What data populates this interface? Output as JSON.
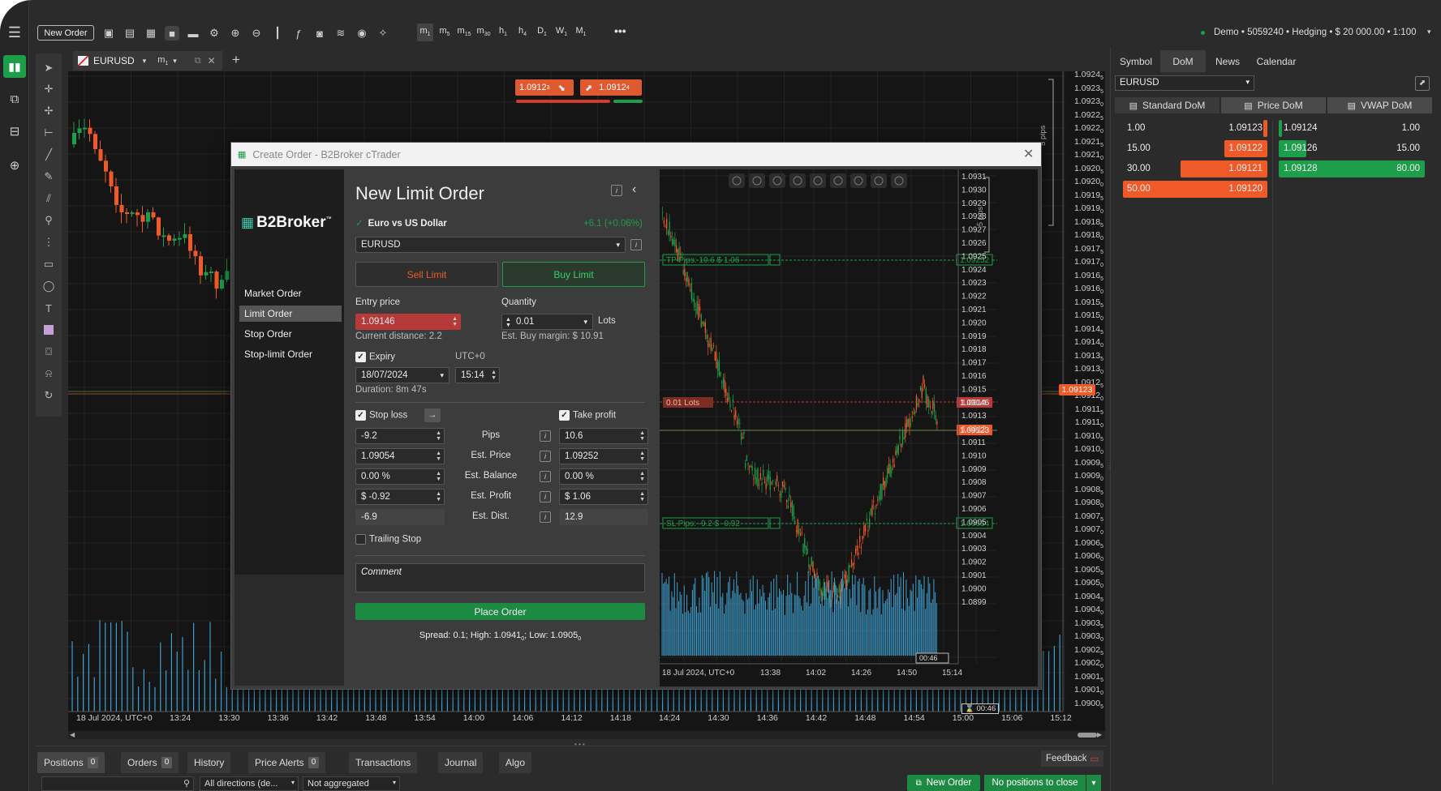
{
  "toolbar": {
    "new_order": "New Order",
    "timeframes": [
      {
        "main": "m",
        "sub": "1"
      },
      {
        "main": "m",
        "sub": "5"
      },
      {
        "main": "m",
        "sub": "15"
      },
      {
        "main": "m",
        "sub": "30"
      },
      {
        "main": "h",
        "sub": "1"
      },
      {
        "main": "h",
        "sub": "4"
      },
      {
        "main": "D",
        "sub": "1"
      },
      {
        "main": "W",
        "sub": "1"
      },
      {
        "main": "M",
        "sub": "1"
      }
    ],
    "account": "Demo • 5059240 • Hedging • $ 20 000.00 • 1:100"
  },
  "chart_tab": {
    "symbol": "EURUSD",
    "timeframe_main": "m",
    "timeframe_sub": "1"
  },
  "quick_trade": {
    "sell": "1.0912",
    "sell_sup": "3",
    "buy": "1.0912",
    "buy_sup": "4"
  },
  "main_chart": {
    "y_labels": [
      "1.0924",
      "1.0923",
      "1.0923",
      "1.0922",
      "1.0922",
      "1.0921",
      "1.0921",
      "1.0920",
      "1.0920",
      "1.0919",
      "1.0919",
      "1.0918",
      "1.0918",
      "1.0917",
      "1.0917",
      "1.0916",
      "1.0916",
      "1.0915",
      "1.0915",
      "1.0914",
      "1.0914",
      "1.0913",
      "1.0913",
      "1.0912",
      "1.0912",
      "1.0911",
      "1.0911",
      "1.0910",
      "1.0910",
      "1.0909",
      "1.0909",
      "1.0908",
      "1.0908",
      "1.0907",
      "1.0907",
      "1.0906",
      "1.0906",
      "1.0905",
      "1.0905",
      "1.0904",
      "1.0904",
      "1.0903",
      "1.0903",
      "1.0902",
      "1.0902",
      "1.0901",
      "1.0901",
      "1.0900"
    ],
    "y_subs": [
      "5",
      "5",
      "0",
      "5",
      "0",
      "5",
      "0",
      "5",
      "0",
      "5",
      "0",
      "5",
      "0",
      "5",
      "0",
      "5",
      "0",
      "5",
      "0",
      "5",
      "0",
      "5",
      "0",
      "5",
      "0",
      "5",
      "0",
      "5",
      "0",
      "5",
      "0",
      "5",
      "0",
      "5",
      "0",
      "5",
      "0",
      "5",
      "0",
      "5",
      "0",
      "5",
      "0",
      "5",
      "0",
      "5",
      "0",
      "5"
    ],
    "price_tag": "1.09123",
    "x_labels": [
      "18 Jul 2024, UTC+0",
      "13:24",
      "13:30",
      "13:36",
      "13:42",
      "13:48",
      "13:54",
      "14:00",
      "14:06",
      "14:12",
      "14:18",
      "14:24",
      "14:30",
      "14:36",
      "14:42",
      "14:48",
      "14:54",
      "15:00",
      "15:06",
      "15:12"
    ],
    "countdown": "00:46",
    "pips_label": "5 pips"
  },
  "dialog": {
    "title": "Create Order - B2Broker cTrader",
    "brand": "B2Broker",
    "menu": [
      "Market Order",
      "Limit Order",
      "Stop Order",
      "Stop-limit Order"
    ],
    "heading": "New Limit Order",
    "instrument_name": "Euro vs US Dollar",
    "change": "+6.1 (+0.06%)",
    "symbol": "EURUSD",
    "sell_limit": "Sell Limit",
    "buy_limit": "Buy Limit",
    "entry_price_label": "Entry price",
    "entry_price": "1.09146",
    "current_distance": "Current distance: 2.2",
    "quantity_label": "Quantity",
    "quantity": "0.01",
    "lots": "Lots",
    "est_buy_margin": "Est. Buy margin: $ 10.91",
    "expiry_label": "Expiry",
    "utc_label": "UTC+0",
    "expiry_date": "18/07/2024",
    "expiry_time": "15:14",
    "duration": "Duration: 8m 47s",
    "stop_loss_label": "Stop loss",
    "take_profit_label": "Take profit",
    "rows": [
      {
        "label": "Pips",
        "sl": "-9.2",
        "tp": "10.6"
      },
      {
        "label": "Est. Price",
        "sl": "1.09054",
        "tp": "1.09252"
      },
      {
        "label": "Est. Balance",
        "sl": "0.00 %",
        "tp": "0.00 %"
      },
      {
        "label": "Est. Profit",
        "sl": "$ -0.92",
        "tp": "$ 1.06"
      },
      {
        "label": "Est. Dist.",
        "sl": "-6.9",
        "tp": "12.9"
      }
    ],
    "trailing_stop": "Trailing Stop",
    "comment_placeholder": "Comment",
    "place_order": "Place Order",
    "spread_info": "Spread: 0.1; High: 1.0941",
    "spread_high_sub": "0",
    "spread_low": "; Low: 1.0905",
    "spread_low_sub": "0"
  },
  "mini_chart": {
    "y_labels": [
      "1.0931",
      "1.0930",
      "1.0929",
      "1.0928",
      "1.0927",
      "1.0926",
      "1.0925",
      "1.0924",
      "1.0923",
      "1.0922",
      "1.0921",
      "1.0920",
      "1.0919",
      "1.0918",
      "1.0917",
      "1.0916",
      "1.0915",
      "1.0914",
      "1.0913",
      "1.0912",
      "1.0911",
      "1.0910",
      "1.0909",
      "1.0908",
      "1.0907",
      "1.0906",
      "1.0905",
      "1.0904",
      "1.0903",
      "1.0902",
      "1.0901",
      "1.0900",
      "1.0899"
    ],
    "tp_label": "TP   Pips: 10.6   $ 1.06",
    "tp_price": "1.09252",
    "sl_label": "SL   Pips: -9.2   $ -0.92",
    "sl_price": "1.09054",
    "order_label": "0.01 Lots",
    "order_price": "1.09146",
    "price_tag": "1.09123",
    "x_labels": [
      "18 Jul 2024, UTC+0",
      "13:38",
      "14:02",
      "14:26",
      "14:50",
      "15:14"
    ],
    "countdown": "00:46",
    "pips_label": "5 pips"
  },
  "right_panel": {
    "tabs": [
      "Symbol",
      "DoM",
      "News",
      "Calendar"
    ],
    "symbol": "EURUSD",
    "dom_tabs": [
      "Standard DoM",
      "Price DoM",
      "VWAP DoM"
    ],
    "bids": [
      {
        "volume": "1.00",
        "price": "1.09123",
        "fill": 0.03
      },
      {
        "volume": "15.00",
        "price": "1.09122",
        "fill": 0.3
      },
      {
        "volume": "30.00",
        "price": "1.09121",
        "fill": 0.6
      },
      {
        "volume": "50.00",
        "price": "1.09120",
        "fill": 1.0
      }
    ],
    "asks": [
      {
        "price": "1.09124",
        "volume": "1.00",
        "fill": 0.02
      },
      {
        "price": "1.09126",
        "volume": "15.00",
        "fill": 0.19
      },
      {
        "price": "1.09128",
        "volume": "80.00",
        "fill": 1.0
      }
    ]
  },
  "bottom": {
    "tabs": [
      {
        "label": "Positions",
        "badge": "0"
      },
      {
        "label": "Orders",
        "badge": "0"
      },
      {
        "label": "History",
        "badge": ""
      },
      {
        "label": "Price Alerts",
        "badge": "0"
      },
      {
        "label": "Transactions",
        "badge": ""
      },
      {
        "label": "Journal",
        "badge": ""
      },
      {
        "label": "Algo",
        "badge": ""
      }
    ],
    "feedback": "Feedback",
    "directions": "All directions (de...",
    "aggregation": "Not aggregated",
    "new_order": "New Order",
    "no_positions": "No positions to close"
  },
  "colors": {
    "sell": "#f05a28",
    "buy": "#1d9e4a",
    "order_line": "#c0392b",
    "volume": "#3f9fd0"
  }
}
